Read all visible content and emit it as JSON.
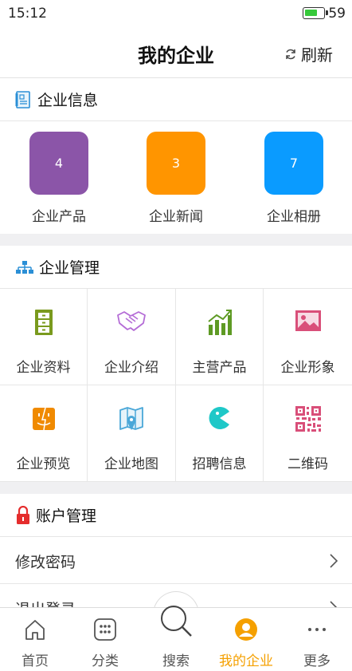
{
  "status_bar": {
    "time": "15:12",
    "battery_level": "59",
    "battery_color": "#36c93a"
  },
  "nav": {
    "title": "我的企业",
    "refresh_label": "刷新"
  },
  "sections": {
    "info": {
      "title": "企业信息",
      "icon": "document-icon"
    },
    "manage": {
      "title": "企业管理",
      "icon": "org-chart-icon"
    },
    "account": {
      "title": "账户管理",
      "icon": "lock-icon"
    }
  },
  "info_cards": [
    {
      "count": "4",
      "label": "企业产品",
      "color": "#8b55a8"
    },
    {
      "count": "3",
      "label": "企业新闻",
      "color": "#ff9500"
    },
    {
      "count": "7",
      "label": "企业相册",
      "color": "#0a9bff"
    }
  ],
  "manage_grid": [
    {
      "label": "企业资料",
      "icon": "cabinet-icon",
      "color": "#7a9a1e"
    },
    {
      "label": "企业介绍",
      "icon": "handshake-icon",
      "color": "#b46cd6"
    },
    {
      "label": "主营产品",
      "icon": "growth-chart-icon",
      "color": "#5e9a24"
    },
    {
      "label": "企业形象",
      "icon": "picture-icon",
      "color": "#d94f79"
    },
    {
      "label": "企业预览",
      "icon": "finder-face-icon",
      "color": "#f08a00"
    },
    {
      "label": "企业地图",
      "icon": "map-icon",
      "color": "#4aa7d8"
    },
    {
      "label": "招聘信息",
      "icon": "pacman-icon",
      "color": "#1fc8c8"
    },
    {
      "label": "二维码",
      "icon": "qr-code-icon",
      "color": "#d94f79"
    }
  ],
  "account_rows": [
    {
      "label": "修改密码"
    },
    {
      "label": "退出登录"
    }
  ],
  "tabs": [
    {
      "label": "首页",
      "icon": "home-icon"
    },
    {
      "label": "分类",
      "icon": "grid-dots-icon"
    },
    {
      "label": "搜索",
      "icon": "search-icon"
    },
    {
      "label": "我的企业",
      "icon": "user-icon",
      "active": true
    },
    {
      "label": "更多",
      "icon": "more-icon"
    }
  ],
  "accent_color": "#f5a000"
}
